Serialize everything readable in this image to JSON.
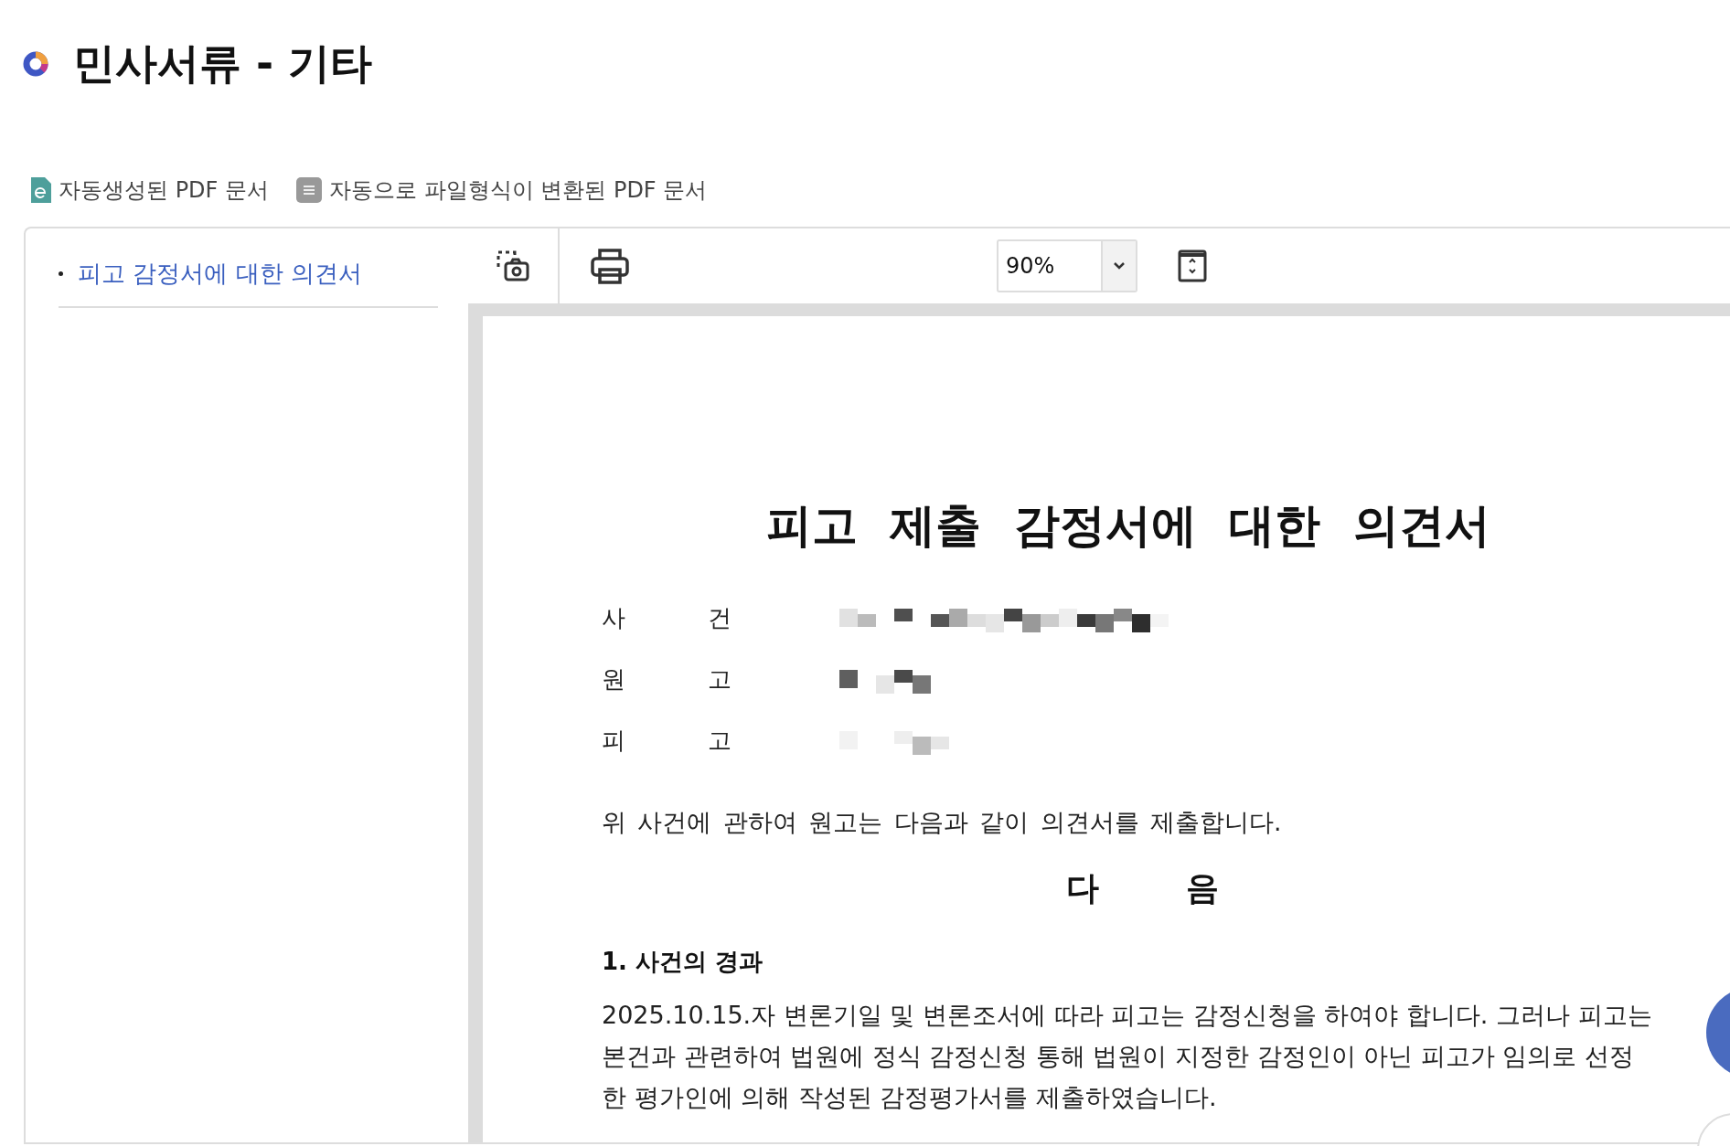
{
  "page_title": "민사서류 - 기타",
  "legend": [
    {
      "kind": "generated",
      "label": "자동생성된 PDF 문서"
    },
    {
      "kind": "converted",
      "label": "자동으로 파일형식이 변환된 PDF 문서"
    }
  ],
  "sidebar": {
    "items": [
      {
        "label": "피고 감정서에 대한 의견서",
        "selected": true
      }
    ]
  },
  "toolbar": {
    "zoom": "90%"
  },
  "document": {
    "title": "피고 제출 감정서에 대한 의견서",
    "parties": [
      {
        "label": "사 건"
      },
      {
        "label": "원 고"
      },
      {
        "label": "피 고"
      }
    ],
    "intro": "위 사건에 관하여 원고는 다음과 같이 의견서를 제출합니다.",
    "heading": "다 음",
    "section_title": "1. 사건의 경과",
    "body_lines": [
      "2025.10.15.자 변론기일 및 변론조서에 따라 피고는 감정신청을 하여야 합니다. 그러나 피고는",
      "본건과 관련하여 법원에 정식 감정신청 통해 법원이 지정한 감정인이 아닌 피고가 임의로 선정",
      "한 평가인에 의해 작성된 감정평가서를 제출하였습니다."
    ]
  }
}
